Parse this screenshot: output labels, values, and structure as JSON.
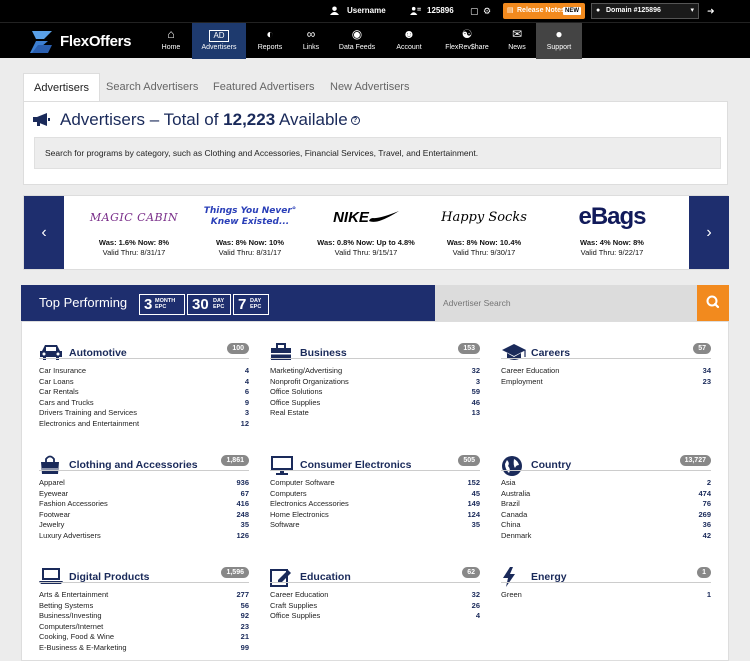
{
  "topbar": {
    "username": "Username",
    "account_id": "125896",
    "release_notes": "Release Notes",
    "new_badge": "NEW",
    "domain": "Domain #125896"
  },
  "brand": "FlexOffers",
  "nav": [
    {
      "label": "Home",
      "icon": "home-icon"
    },
    {
      "label": "Advertisers",
      "icon": "ad-icon",
      "icon_text": "AD"
    },
    {
      "label": "Reports",
      "icon": "reports-icon"
    },
    {
      "label": "Links",
      "icon": "link-icon"
    },
    {
      "label": "Data Feeds",
      "icon": "datafeed-icon"
    },
    {
      "label": "Account",
      "icon": "account-icon"
    },
    {
      "label": "FlexRev$hare",
      "icon": "flexrevshare-icon"
    },
    {
      "label": "News",
      "icon": "news-icon"
    },
    {
      "label": "Support",
      "icon": "support-icon"
    }
  ],
  "tabs": [
    "Advertisers",
    "Search Advertisers",
    "Featured Advertisers",
    "New Advertisers"
  ],
  "header": {
    "title_prefix": "Advertisers – Total of",
    "title_count": "12,223",
    "title_suffix": "Available",
    "help": "?",
    "hint": "Search for programs by category, such as Clothing and Accessories, Financial Services, Travel, and Entertainment."
  },
  "offers": [
    {
      "brand": "MAGIC CABIN",
      "rate": "Was: 1.6% Now: 8%",
      "valid": "Valid Thru: 8/31/17"
    },
    {
      "brand": "Things You Never Knew Existed...",
      "brand_line1": "Things You Never°",
      "brand_line2": "Knew Existed...",
      "rate": "Was: 8% Now: 10%",
      "valid": "Valid Thru: 8/31/17"
    },
    {
      "brand": "NIKE",
      "rate": "Was: 0.8% Now: Up to 4.8%",
      "valid": "Valid Thru: 9/15/17"
    },
    {
      "brand": "Happy Socks",
      "rate": "Was: 8% Now: 10.4%",
      "valid": "Valid Thru: 9/30/17"
    },
    {
      "brand": "eBags",
      "rate": "Was: 4% Now: 8%",
      "valid": "Valid Thru: 9/22/17"
    }
  ],
  "top_performing": {
    "title": "Top Performing",
    "epc": [
      {
        "num": "3",
        "unit1": "MONTH",
        "unit2": "EPC"
      },
      {
        "num": "30",
        "unit1": "DAY",
        "unit2": "EPC"
      },
      {
        "num": "7",
        "unit1": "DAY",
        "unit2": "EPC"
      }
    ],
    "search_placeholder": "Advertiser Search"
  },
  "categories": [
    {
      "title": "Automotive",
      "icon": "car-icon",
      "count": "100",
      "items": [
        {
          "name": "Car Insurance",
          "n": "4"
        },
        {
          "name": "Car Loans",
          "n": "4"
        },
        {
          "name": "Car Rentals",
          "n": "6"
        },
        {
          "name": "Cars and Trucks",
          "n": "9"
        },
        {
          "name": "Drivers Training and Services",
          "n": "3"
        },
        {
          "name": "Electronics and Entertainment",
          "n": "12"
        }
      ]
    },
    {
      "title": "Business",
      "icon": "briefcase-icon",
      "count": "153",
      "items": [
        {
          "name": "Marketing/Advertising",
          "n": "32"
        },
        {
          "name": "Nonprofit Organizations",
          "n": "3"
        },
        {
          "name": "Office Solutions",
          "n": "59"
        },
        {
          "name": "Office Supplies",
          "n": "46"
        },
        {
          "name": "Real Estate",
          "n": "13"
        }
      ]
    },
    {
      "title": "Careers",
      "icon": "graduation-cap-icon",
      "count": "57",
      "items": [
        {
          "name": "Career Education",
          "n": "34"
        },
        {
          "name": "Employment",
          "n": "23"
        }
      ]
    },
    {
      "title": "Clothing and Accessories",
      "icon": "shopping-bag-icon",
      "count": "1,861",
      "items": [
        {
          "name": "Apparel",
          "n": "936"
        },
        {
          "name": "Eyewear",
          "n": "67"
        },
        {
          "name": "Fashion Accessories",
          "n": "416"
        },
        {
          "name": "Footwear",
          "n": "248"
        },
        {
          "name": "Jewelry",
          "n": "35"
        },
        {
          "name": "Luxury Advertisers",
          "n": "126"
        }
      ]
    },
    {
      "title": "Consumer Electronics",
      "icon": "monitor-icon",
      "count": "505",
      "items": [
        {
          "name": "Computer Software",
          "n": "152"
        },
        {
          "name": "Computers",
          "n": "45"
        },
        {
          "name": "Electronics Accessories",
          "n": "149"
        },
        {
          "name": "Home Electronics",
          "n": "124"
        },
        {
          "name": "Software",
          "n": "35"
        }
      ]
    },
    {
      "title": "Country",
      "icon": "globe-icon",
      "count": "13,727",
      "items": [
        {
          "name": "Asia",
          "n": "2"
        },
        {
          "name": "Australia",
          "n": "474"
        },
        {
          "name": "Brazil",
          "n": "76"
        },
        {
          "name": "Canada",
          "n": "269"
        },
        {
          "name": "China",
          "n": "36"
        },
        {
          "name": "Denmark",
          "n": "42"
        }
      ]
    },
    {
      "title": "Digital Products",
      "icon": "laptop-icon",
      "count": "1,596",
      "items": [
        {
          "name": "Arts & Entertainment",
          "n": "277"
        },
        {
          "name": "Betting Systems",
          "n": "56"
        },
        {
          "name": "Business/Investing",
          "n": "92"
        },
        {
          "name": "Computers/Internet",
          "n": "23"
        },
        {
          "name": "Cooking, Food & Wine",
          "n": "21"
        },
        {
          "name": "E-Business & E-Marketing",
          "n": "99"
        }
      ]
    },
    {
      "title": "Education",
      "icon": "edit-icon",
      "count": "62",
      "items": [
        {
          "name": "Career Education",
          "n": "32"
        },
        {
          "name": "Craft Supplies",
          "n": "26"
        },
        {
          "name": "Office Supplies",
          "n": "4"
        }
      ]
    },
    {
      "title": "Energy",
      "icon": "lightning-icon",
      "count": "1",
      "items": [
        {
          "name": "Green",
          "n": "1"
        }
      ]
    }
  ]
}
